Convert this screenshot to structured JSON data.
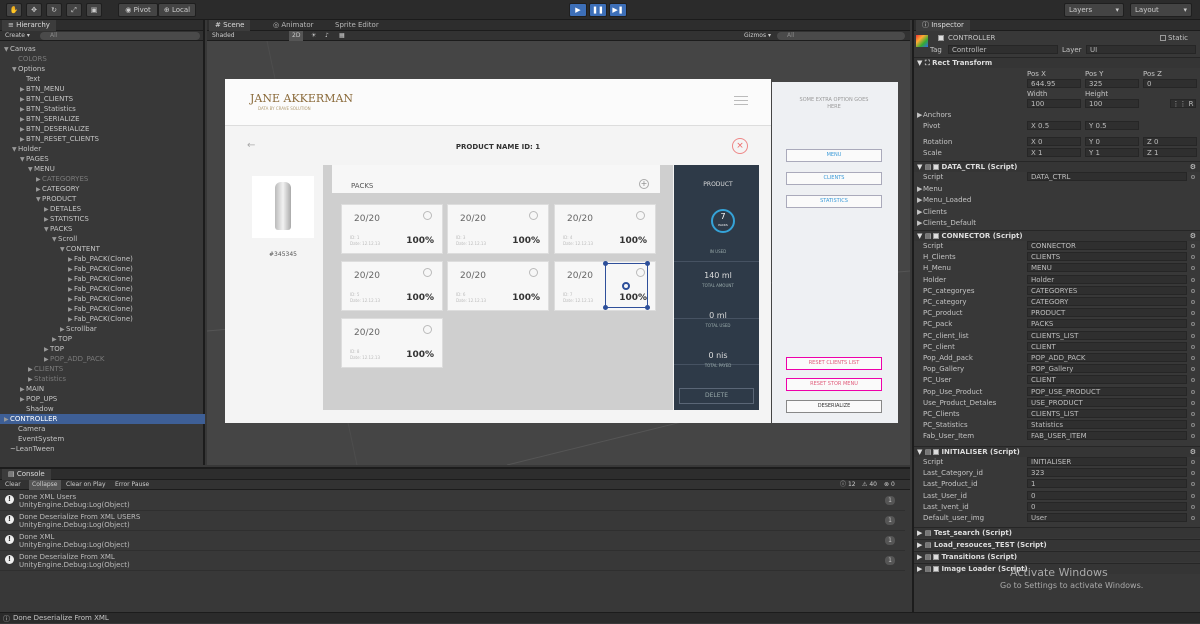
{
  "toolbar": {
    "pivot": "Pivot",
    "local": "Local",
    "layers": "Layers",
    "layout": "Layout"
  },
  "hierarchy": {
    "tab": "Hierarchy",
    "create": "Create",
    "search": "All",
    "rows": [
      {
        "label": "Canvas",
        "indent": 0,
        "arrow": "▼",
        "dim": false
      },
      {
        "label": "COLORS",
        "indent": 1,
        "arrow": "",
        "dim": true
      },
      {
        "label": "Options",
        "indent": 1,
        "arrow": "▼",
        "dim": false
      },
      {
        "label": "Text",
        "indent": 2,
        "arrow": "",
        "dim": false
      },
      {
        "label": "BTN_MENU",
        "indent": 2,
        "arrow": "▶",
        "dim": false
      },
      {
        "label": "BTN_CLIENTS",
        "indent": 2,
        "arrow": "▶",
        "dim": false
      },
      {
        "label": "BTN_Statistics",
        "indent": 2,
        "arrow": "▶",
        "dim": false
      },
      {
        "label": "BTN_SERIALIZE",
        "indent": 2,
        "arrow": "▶",
        "dim": false
      },
      {
        "label": "BTN_DESERIALIZE",
        "indent": 2,
        "arrow": "▶",
        "dim": false
      },
      {
        "label": "BTN_RESET_CLIENTS",
        "indent": 2,
        "arrow": "▶",
        "dim": false
      },
      {
        "label": "Holder",
        "indent": 1,
        "arrow": "▼",
        "dim": false
      },
      {
        "label": "PAGES",
        "indent": 2,
        "arrow": "▼",
        "dim": false
      },
      {
        "label": "MENU",
        "indent": 3,
        "arrow": "▼",
        "dim": false
      },
      {
        "label": "CATEGORYES",
        "indent": 4,
        "arrow": "▶",
        "dim": true
      },
      {
        "label": "CATEGORY",
        "indent": 4,
        "arrow": "▶",
        "dim": false
      },
      {
        "label": "PRODUCT",
        "indent": 4,
        "arrow": "▼",
        "dim": false
      },
      {
        "label": "DETALES",
        "indent": 5,
        "arrow": "▶",
        "dim": false
      },
      {
        "label": "STATISTICS",
        "indent": 5,
        "arrow": "▶",
        "dim": false
      },
      {
        "label": "PACKS",
        "indent": 5,
        "arrow": "▼",
        "dim": false
      },
      {
        "label": "Scroll",
        "indent": 6,
        "arrow": "▼",
        "dim": false
      },
      {
        "label": "CONTENT",
        "indent": 7,
        "arrow": "▼",
        "dim": false
      },
      {
        "label": "Fab_PACK(Clone)",
        "indent": 8,
        "arrow": "▶",
        "dim": false
      },
      {
        "label": "Fab_PACK(Clone)",
        "indent": 8,
        "arrow": "▶",
        "dim": false
      },
      {
        "label": "Fab_PACK(Clone)",
        "indent": 8,
        "arrow": "▶",
        "dim": false
      },
      {
        "label": "Fab_PACK(Clone)",
        "indent": 8,
        "arrow": "▶",
        "dim": false
      },
      {
        "label": "Fab_PACK(Clone)",
        "indent": 8,
        "arrow": "▶",
        "dim": false
      },
      {
        "label": "Fab_PACK(Clone)",
        "indent": 8,
        "arrow": "▶",
        "dim": false
      },
      {
        "label": "Fab_PACK(Clone)",
        "indent": 8,
        "arrow": "▶",
        "dim": false
      },
      {
        "label": "Scrollbar",
        "indent": 7,
        "arrow": "▶",
        "dim": false
      },
      {
        "label": "TOP",
        "indent": 6,
        "arrow": "▶",
        "dim": false
      },
      {
        "label": "TOP",
        "indent": 5,
        "arrow": "▶",
        "dim": false
      },
      {
        "label": "POP_ADD_PACK",
        "indent": 5,
        "arrow": "▶",
        "dim": true
      },
      {
        "label": "CLIENTS",
        "indent": 3,
        "arrow": "▶",
        "dim": true
      },
      {
        "label": "Statistics",
        "indent": 3,
        "arrow": "▶",
        "dim": true
      },
      {
        "label": "MAIN",
        "indent": 2,
        "arrow": "▶",
        "dim": false
      },
      {
        "label": "POP_UPS",
        "indent": 2,
        "arrow": "▶",
        "dim": false
      },
      {
        "label": "Shadow",
        "indent": 2,
        "arrow": "",
        "dim": false
      },
      {
        "label": "CONTROLLER",
        "indent": 0,
        "arrow": "▶",
        "dim": false,
        "selected": true
      },
      {
        "label": "Camera",
        "indent": 1,
        "arrow": "",
        "dim": false
      },
      {
        "label": "EventSystem",
        "indent": 1,
        "arrow": "",
        "dim": false
      },
      {
        "label": "~LeanTween",
        "indent": 0,
        "arrow": "",
        "dim": false
      }
    ]
  },
  "scene": {
    "tabs": [
      "Scene",
      "Animator",
      "Sprite Editor"
    ],
    "shaded": "Shaded",
    "mode2d": "2D",
    "gizmos": "Gizmos",
    "search": "All"
  },
  "app": {
    "brand": "JANE AKKERMAN",
    "brand_sub": "DATA BY CRAVE SOLUTION",
    "page_title": "PRODUCT NAME ID: 1",
    "barcode": "#345345",
    "packs_title": "PACKS",
    "cards": [
      {
        "q": "20/20",
        "id": "ID: 1",
        "date": "Date: 12.12.13",
        "pct": "100%"
      },
      {
        "q": "20/20",
        "id": "ID: 3",
        "date": "Date: 12.12.13",
        "pct": "100%"
      },
      {
        "q": "20/20",
        "id": "ID: 4",
        "date": "Date: 12.12.13",
        "pct": "100%"
      },
      {
        "q": "20/20",
        "id": "ID: 5",
        "date": "Date: 12.12.13",
        "pct": "100%"
      },
      {
        "q": "20/20",
        "id": "ID: 6",
        "date": "Date: 12.12.13",
        "pct": "100%"
      },
      {
        "q": "20/20",
        "id": "ID: 7",
        "date": "Date: 12.12.13",
        "pct": "100%"
      },
      {
        "q": "20/20",
        "id": "ID: 8",
        "date": "Date: 12.12.13",
        "pct": "100%"
      }
    ],
    "product_label": "PRODUCT",
    "packs_count": "7",
    "packs_word": "PACKS",
    "in_used": "IN USED",
    "amount": "140 ml",
    "amount_label": "TOTAL AMOUNT",
    "used": "0 ml",
    "used_label": "TOTAL USED",
    "payed": "0 nis",
    "payed_label": "TOTAL PAYED",
    "delete": "DELETE",
    "side_note": "SOME EXTRA OPTION GOES HERE",
    "btn_menu": "MENU",
    "btn_clients": "CLIENTS",
    "btn_stats": "STATISTICS",
    "btn_reset": "RESET CLIENTS LIST",
    "btn_reset2": "RESET STOR MENU",
    "btn_deser": "DESERIALIZE"
  },
  "console": {
    "tab": "Console",
    "buttons": [
      "Clear",
      "Collapse",
      "Clear on Play",
      "Error Pause"
    ],
    "n_info": "12",
    "n_warn": "40",
    "n_err": "0",
    "rows": [
      {
        "l1": "Done XML Users",
        "l2": "UnityEngine.Debug:Log(Object)",
        "count": "1"
      },
      {
        "l1": "Done Deserialize From XML USERS",
        "l2": "UnityEngine.Debug:Log(Object)",
        "count": "1"
      },
      {
        "l1": "Done XML",
        "l2": "UnityEngine.Debug:Log(Object)",
        "count": "1"
      },
      {
        "l1": "Done Deserialize From XML",
        "l2": "UnityEngine.Debug:Log(Object)",
        "count": "1"
      }
    ],
    "status": "Done Deserialize From XML"
  },
  "inspector": {
    "tab": "Inspector",
    "name": "CONTROLLER",
    "static": "Static",
    "tag_label": "Tag",
    "tag": "Controller",
    "layer_label": "Layer",
    "layer": "UI",
    "rect": "Rect Transform",
    "posx_l": "Pos X",
    "posy_l": "Pos Y",
    "posz_l": "Pos Z",
    "posx": "644.95",
    "posy": "325",
    "posz": "0",
    "w_l": "Width",
    "h_l": "Height",
    "w": "100",
    "h": "100",
    "anchors": "Anchors",
    "pivot": "Pivot",
    "pivot_x": "X  0.5",
    "pivot_y": "Y  0.5",
    "rotation": "Rotation",
    "rot_x": "X  0",
    "rot_y": "Y  0",
    "rot_z": "Z  0",
    "scale": "Scale",
    "sc_x": "X  1",
    "sc_y": "Y  1",
    "sc_z": "Z  1",
    "data_ctrl": "DATA_CTRL (Script)",
    "data_rows": [
      [
        "Script",
        "DATA_CTRL"
      ],
      [
        "Menu",
        ""
      ],
      [
        "Menu_Loaded",
        ""
      ],
      [
        "Clients",
        ""
      ],
      [
        "Clients_Default",
        ""
      ]
    ],
    "connector": "CONNECTOR (Script)",
    "conn_rows": [
      [
        "Script",
        "CONNECTOR"
      ],
      [
        "H_Clients",
        "CLIENTS"
      ],
      [
        "H_Menu",
        "MENU"
      ],
      [
        "Holder",
        "Holder"
      ],
      [
        "PC_categoryes",
        "CATEGORYES"
      ],
      [
        "PC_category",
        "CATEGORY"
      ],
      [
        "PC_product",
        "PRODUCT"
      ],
      [
        "PC_pack",
        "PACKS"
      ],
      [
        "PC_client_list",
        "CLIENTS_LIST"
      ],
      [
        "PC_client",
        "CLIENT"
      ],
      [
        "Pop_Add_pack",
        "POP_ADD_PACK"
      ],
      [
        "Pop_Gallery",
        "POP_Gallery"
      ],
      [
        "PC_User",
        "CLIENT"
      ],
      [
        "Pop_Use_Product",
        "POP_USE_PRODUCT"
      ],
      [
        "Use_Product_Detales",
        "USE_PRODUCT"
      ],
      [
        "PC_Clients",
        "CLIENTS_LIST"
      ],
      [
        "PC_Statistics",
        "Statistics"
      ],
      [
        "Fab_User_Item",
        "FAB_USER_ITEM"
      ]
    ],
    "initialiser": "INITIALISER (Script)",
    "init_rows": [
      [
        "Script",
        "INITIALISER"
      ],
      [
        "Last_Category_id",
        "323"
      ],
      [
        "Last_Product_id",
        "1"
      ],
      [
        "Last_User_id",
        "0"
      ],
      [
        "Last_Ivent_id",
        "0"
      ],
      [
        "Default_user_img",
        "User"
      ]
    ],
    "test": "Test_search (Script)",
    "load": "Load_resouces_TEST (Script)",
    "trans": "Transitions (Script)",
    "imgl": "Image Loader (Script)",
    "watermark1": "Activate Windows",
    "watermark2": "Go to Settings to activate Windows."
  }
}
